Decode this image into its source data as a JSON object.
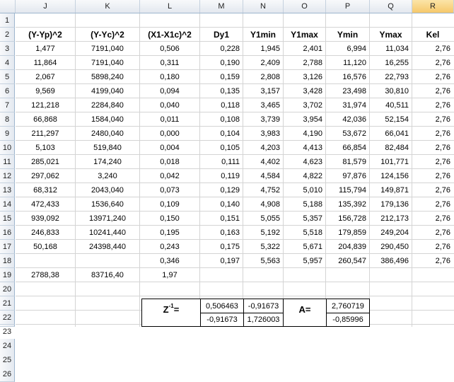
{
  "columns": [
    "J",
    "K",
    "L",
    "M",
    "N",
    "O",
    "P",
    "Q",
    "R"
  ],
  "selected_column": "R",
  "rows": [
    "1",
    "2",
    "3",
    "4",
    "5",
    "6",
    "7",
    "8",
    "9",
    "10",
    "11",
    "12",
    "13",
    "14",
    "15",
    "16",
    "17",
    "18",
    "19",
    "20",
    "21",
    "22",
    "23",
    "24",
    "25",
    "26"
  ],
  "headers": [
    "(Y-Yp)^2",
    "(Y-Yc)^2",
    "(X1-X1c)^2",
    "Dy1",
    "Y1min",
    "Y1max",
    "Ymin",
    "Ymax",
    "Kel"
  ],
  "data_rows": [
    [
      "1,477",
      "7191,040",
      "0,506",
      "0,228",
      "1,945",
      "2,401",
      "6,994",
      "11,034",
      "2,76"
    ],
    [
      "11,864",
      "7191,040",
      "0,311",
      "0,190",
      "2,409",
      "2,788",
      "11,120",
      "16,255",
      "2,76"
    ],
    [
      "2,067",
      "5898,240",
      "0,180",
      "0,159",
      "2,808",
      "3,126",
      "16,576",
      "22,793",
      "2,76"
    ],
    [
      "9,569",
      "4199,040",
      "0,094",
      "0,135",
      "3,157",
      "3,428",
      "23,498",
      "30,810",
      "2,76"
    ],
    [
      "121,218",
      "2284,840",
      "0,040",
      "0,118",
      "3,465",
      "3,702",
      "31,974",
      "40,511",
      "2,76"
    ],
    [
      "66,868",
      "1584,040",
      "0,011",
      "0,108",
      "3,739",
      "3,954",
      "42,036",
      "52,154",
      "2,76"
    ],
    [
      "211,297",
      "2480,040",
      "0,000",
      "0,104",
      "3,983",
      "4,190",
      "53,672",
      "66,041",
      "2,76"
    ],
    [
      "5,103",
      "519,840",
      "0,004",
      "0,105",
      "4,203",
      "4,413",
      "66,854",
      "82,484",
      "2,76"
    ],
    [
      "285,021",
      "174,240",
      "0,018",
      "0,111",
      "4,402",
      "4,623",
      "81,579",
      "101,771",
      "2,76"
    ],
    [
      "297,062",
      "3,240",
      "0,042",
      "0,119",
      "4,584",
      "4,822",
      "97,876",
      "124,156",
      "2,76"
    ],
    [
      "68,312",
      "2043,040",
      "0,073",
      "0,129",
      "4,752",
      "5,010",
      "115,794",
      "149,871",
      "2,76"
    ],
    [
      "472,433",
      "1536,640",
      "0,109",
      "0,140",
      "4,908",
      "5,188",
      "135,392",
      "179,136",
      "2,76"
    ],
    [
      "939,092",
      "13971,240",
      "0,150",
      "0,151",
      "5,055",
      "5,357",
      "156,728",
      "212,173",
      "2,76"
    ],
    [
      "246,833",
      "10241,440",
      "0,195",
      "0,163",
      "5,192",
      "5,518",
      "179,859",
      "249,204",
      "2,76"
    ],
    [
      "50,168",
      "24398,440",
      "0,243",
      "0,175",
      "5,322",
      "5,671",
      "204,839",
      "290,450",
      "2,76"
    ],
    [
      "",
      "",
      "0,346",
      "0,197",
      "5,563",
      "5,957",
      "260,547",
      "386,496",
      "2,76"
    ],
    [
      "2788,38",
      "83716,40",
      "1,97",
      "",
      "",
      "",
      "",
      "",
      ""
    ]
  ],
  "zinv": {
    "label_base": "Z",
    "label_sup": "-1",
    "label_eq": "=",
    "m": [
      "0,506463",
      "-0,91673",
      "-0,91673",
      "1,726003"
    ]
  },
  "avec": {
    "label": "A=",
    "values": [
      "2,760719",
      "-0,85996"
    ]
  }
}
